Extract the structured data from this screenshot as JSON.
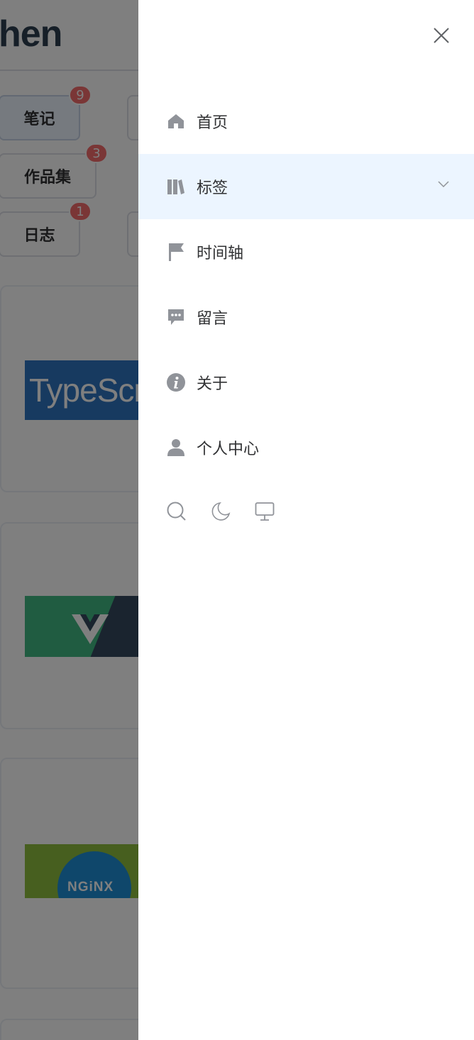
{
  "background": {
    "site_title": "hen",
    "tags": [
      {
        "label": "笔记",
        "count": "9"
      },
      {
        "label": "作品集",
        "count": "3"
      },
      {
        "label": "日志",
        "count": "1"
      }
    ],
    "cards": [
      {
        "thumb_text": "TypeScript"
      },
      {
        "thumb_text": ""
      },
      {
        "thumb_text": "NGiNX"
      }
    ]
  },
  "drawer": {
    "menu": [
      {
        "label": "首页",
        "icon": "home-icon"
      },
      {
        "label": "标签",
        "icon": "tags-icon",
        "expandable": true,
        "highlighted": true
      },
      {
        "label": "时间轴",
        "icon": "flag-icon"
      },
      {
        "label": "留言",
        "icon": "chat-bubble-icon"
      },
      {
        "label": "关于",
        "icon": "info-icon"
      },
      {
        "label": "个人中心",
        "icon": "user-icon"
      }
    ],
    "tools": [
      "search-icon",
      "moon-icon",
      "monitor-icon"
    ]
  },
  "colors": {
    "highlight_bg": "#ecf5ff",
    "badge": "#f56c6c",
    "icon": "#909399",
    "overlay": "rgba(0,0,0,0.5)"
  }
}
